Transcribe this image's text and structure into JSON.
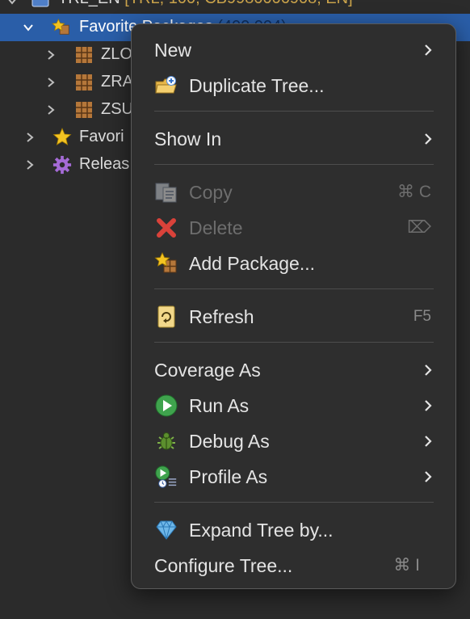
{
  "tree": {
    "top_row": {
      "label": "TRL_EN",
      "meta": "[TRL, 100, CB9980006908, EN]"
    },
    "selected_row": {
      "label": "Favorite Packages",
      "meta": "(400,004)"
    },
    "children": [
      {
        "label": "ZLO"
      },
      {
        "label": "ZRA"
      },
      {
        "label": "ZSU"
      }
    ],
    "other_rows": [
      {
        "label": "Favori",
        "icon": "star-icon"
      },
      {
        "label": "Releas",
        "icon": "gear-icon"
      }
    ]
  },
  "menu": {
    "new": {
      "label": "New"
    },
    "duplicate_tree": {
      "label": "Duplicate Tree...",
      "icon": "duplicate-folder-icon"
    },
    "show_in": {
      "label": "Show In"
    },
    "copy": {
      "label": "Copy",
      "shortcut": "⌘ C",
      "icon": "copy-icon",
      "disabled": true
    },
    "delete": {
      "label": "Delete",
      "shortcut": "⌦",
      "icon": "delete-x-icon",
      "disabled": true
    },
    "add_package": {
      "label": "Add Package...",
      "icon": "add-package-icon"
    },
    "refresh": {
      "label": "Refresh",
      "shortcut": "F5",
      "icon": "refresh-icon"
    },
    "coverage_as": {
      "label": "Coverage As"
    },
    "run_as": {
      "label": "Run As",
      "icon": "run-icon"
    },
    "debug_as": {
      "label": "Debug As",
      "icon": "bug-icon"
    },
    "profile_as": {
      "label": "Profile As",
      "icon": "profile-icon"
    },
    "expand_tree": {
      "label": "Expand Tree by...",
      "icon": "diamond-icon"
    },
    "configure_tree": {
      "label": "Configure Tree...",
      "shortcut": "⌘ I"
    }
  },
  "colors": {
    "selection": "#2a5ea8",
    "menu_bg": "#2e2e2e",
    "meta_text": "#c9a24a",
    "run_green": "#3fa34d",
    "delete_red": "#d9423a"
  }
}
